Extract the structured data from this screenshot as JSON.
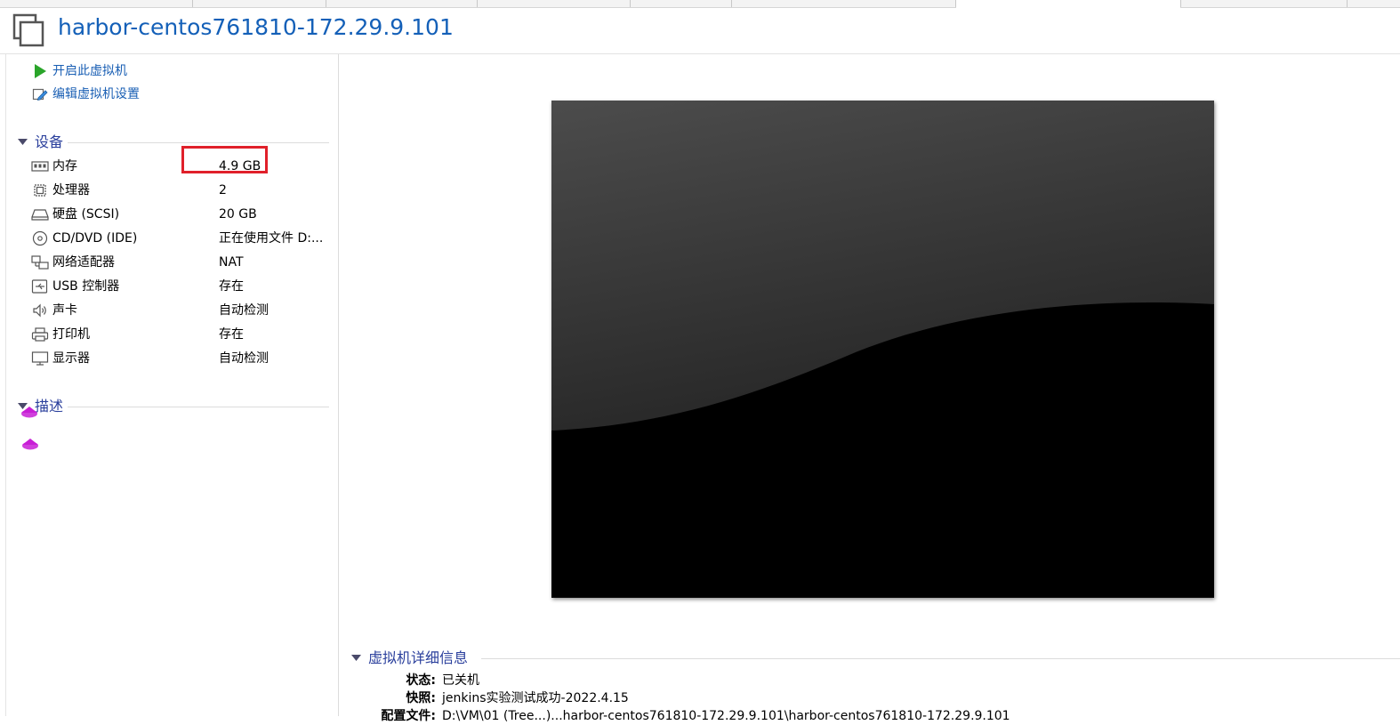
{
  "window": {
    "title": "harbor-centos761810-172.29.9.101"
  },
  "actions": [
    {
      "label": "开启此虚拟机",
      "icon": "play-icon"
    },
    {
      "label": "编辑虚拟机设置",
      "icon": "edit-settings-icon"
    }
  ],
  "devices": {
    "title": "设备",
    "items": [
      {
        "name": "内存",
        "value": "4.9 GB",
        "icon": "memory-icon"
      },
      {
        "name": "处理器",
        "value": "2",
        "icon": "processor-icon"
      },
      {
        "name": "硬盘 (SCSI)",
        "value": "20 GB",
        "icon": "hard-disk-icon"
      },
      {
        "name": "CD/DVD (IDE)",
        "value": "正在使用文件 D:...",
        "icon": "cd-dvd-icon"
      },
      {
        "name": "网络适配器",
        "value": "NAT",
        "icon": "network-adapter-icon"
      },
      {
        "name": "USB 控制器",
        "value": "存在",
        "icon": "usb-icon"
      },
      {
        "name": "声卡",
        "value": "自动检测",
        "icon": "speaker-icon"
      },
      {
        "name": "打印机",
        "value": "存在",
        "icon": "printer-icon"
      },
      {
        "name": "显示器",
        "value": "自动检测",
        "icon": "monitor-icon"
      }
    ]
  },
  "description": {
    "title": "描述"
  },
  "details": {
    "title": "虚拟机详细信息",
    "rows": [
      {
        "key": "状态:",
        "value": "已关机"
      },
      {
        "key": "快照:",
        "value": "jenkins实验测试成功-2022.4.15"
      },
      {
        "key": "配置文件:",
        "value": "D:\\VM\\01 (Tree...)...harbor-centos761810-172.29.9.101\\harbor-centos761810-172.29.9.101"
      }
    ]
  },
  "colors": {
    "accent": "#1460b8",
    "section_title": "#2a3f9c",
    "highlight": "#e0202a",
    "marker": "#c81fd6"
  }
}
